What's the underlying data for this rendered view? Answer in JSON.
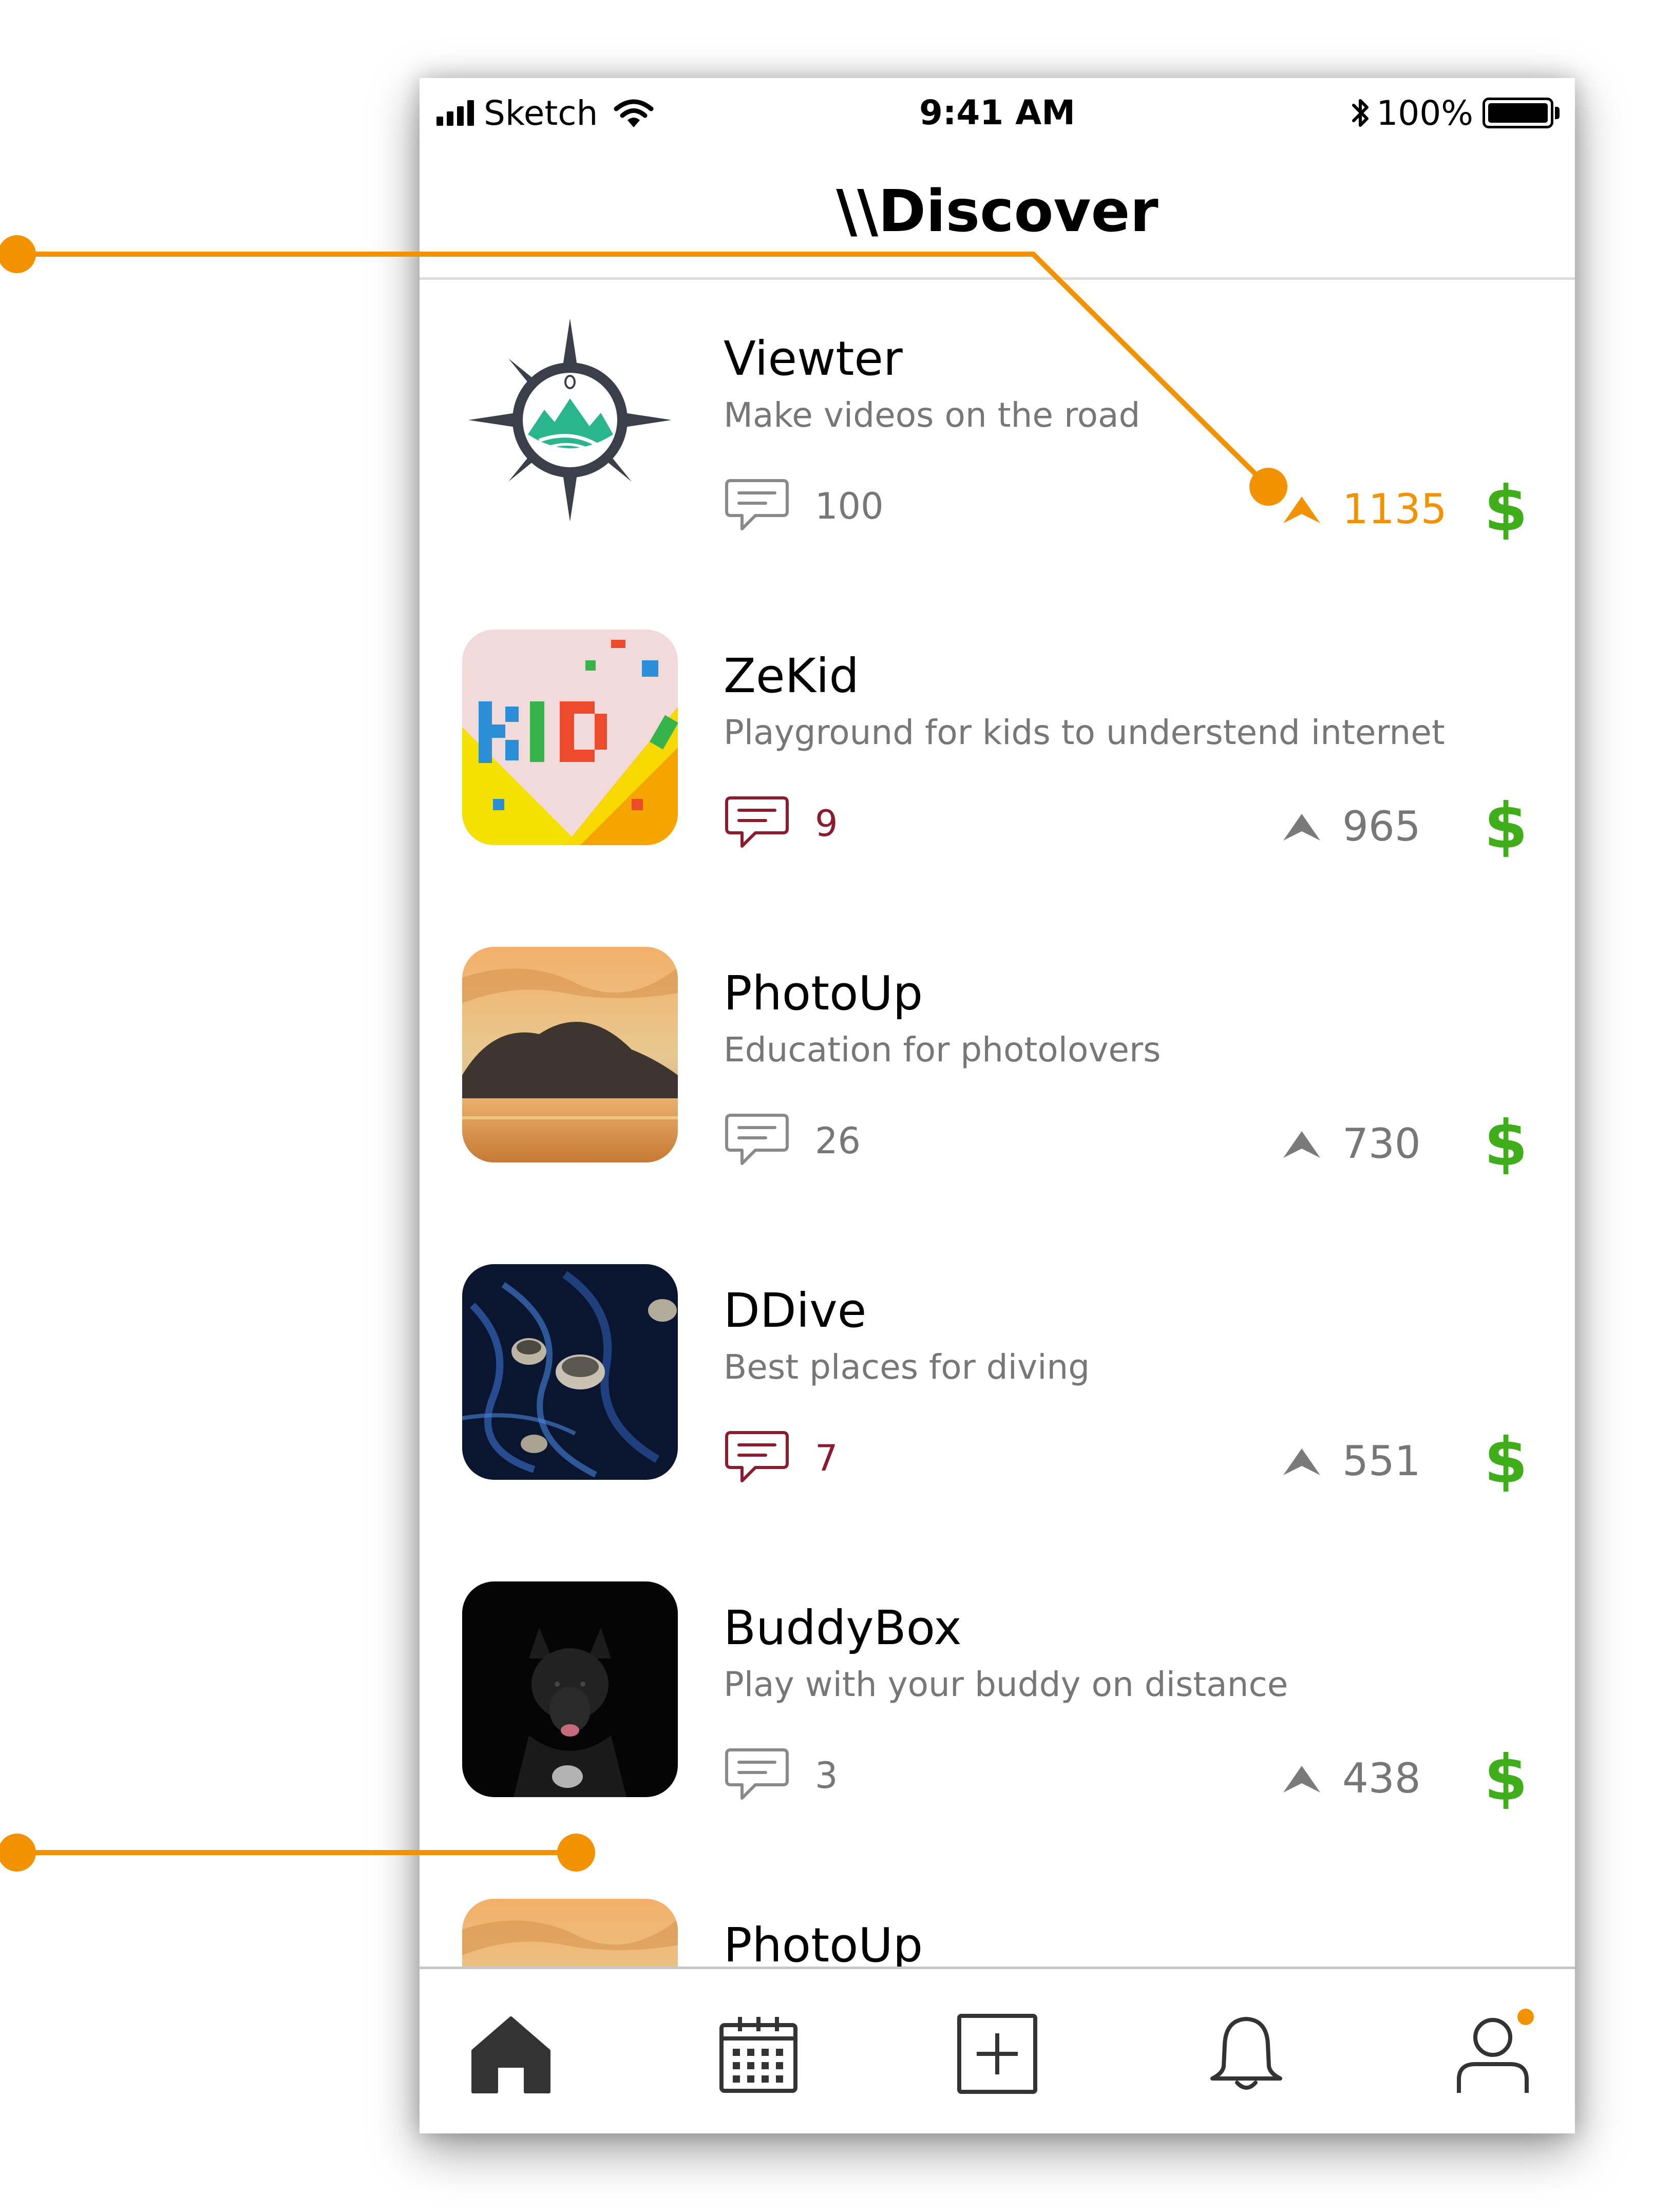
{
  "status_bar": {
    "carrier": "Sketch",
    "time": "9:41 AM",
    "battery": "100%",
    "battery_level": 1.0
  },
  "header": {
    "title": "\\\\Discover"
  },
  "colors": {
    "accent_orange": "#f39200",
    "dollar_green": "#3fae1a",
    "unread_comment": "#8a1c2e",
    "muted_gray": "#777777"
  },
  "items": [
    {
      "title": "Viewter",
      "description": "Make videos on the road",
      "comments": "100",
      "upvotes": "1135",
      "comments_unread": false,
      "upvoted": true,
      "thumbnail": "compass-logo"
    },
    {
      "title": "ZeKid",
      "description": "Playground for kids to understend internet",
      "comments": "9",
      "upvotes": "965",
      "comments_unread": true,
      "upvoted": false,
      "thumbnail": "kid-blocks"
    },
    {
      "title": "PhotoUp",
      "description": "Education for photolovers",
      "comments": "26",
      "upvotes": "730",
      "comments_unread": false,
      "upvoted": false,
      "thumbnail": "sunset-sea"
    },
    {
      "title": "DDive",
      "description": "Best places for diving",
      "comments": "7",
      "upvotes": "551",
      "comments_unread": true,
      "upvoted": false,
      "thumbnail": "jellyfish"
    },
    {
      "title": "BuddyBox",
      "description": "Play with your buddy on distance",
      "comments": "3",
      "upvotes": "438",
      "comments_unread": false,
      "upvoted": false,
      "thumbnail": "black-dog"
    },
    {
      "title": "PhotoUp",
      "description": "",
      "comments": "",
      "upvotes": "",
      "comments_unread": false,
      "upvoted": false,
      "thumbnail": "sunset-sea"
    }
  ],
  "price_symbol": "$",
  "tab_bar": {
    "tabs": [
      {
        "name": "home",
        "icon": "home-icon",
        "active": true
      },
      {
        "name": "calendar",
        "icon": "calendar-icon",
        "active": false
      },
      {
        "name": "add",
        "icon": "plus-square-icon",
        "active": false
      },
      {
        "name": "notifications",
        "icon": "bell-icon",
        "active": false
      },
      {
        "name": "profile",
        "icon": "user-icon",
        "active": false,
        "badge": true
      }
    ]
  }
}
